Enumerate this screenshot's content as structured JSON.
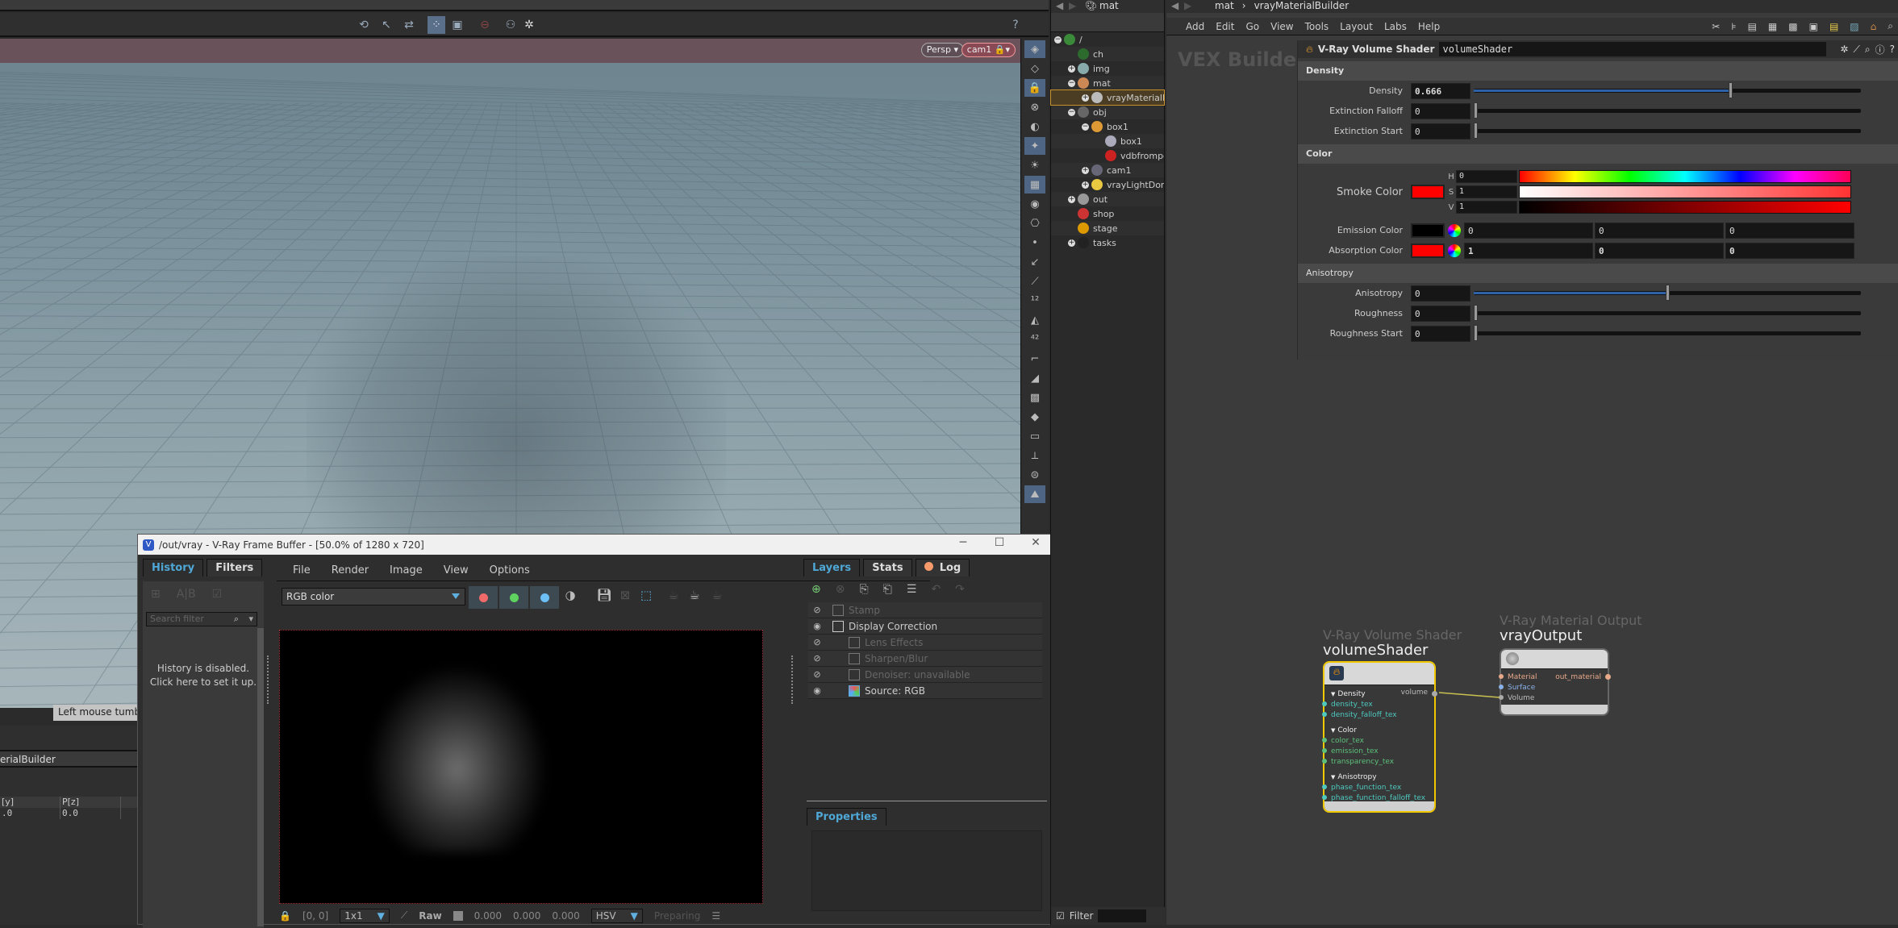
{
  "viewport": {
    "camera_persp": "Persp",
    "camera_name": "cam1",
    "tooltip": "Left mouse tumbles",
    "toolbar_icons": [
      "orbit-icon",
      "select-icon",
      "transform-icon",
      "snap-icon",
      "view-icon",
      "record-icon",
      "flipbook-icon",
      "gear-icon"
    ]
  },
  "lower_left": {
    "path_fragment": "erialBuilder",
    "columns": [
      "[y]",
      "P[z]"
    ],
    "rows": [
      [
        ".0",
        "0.0"
      ]
    ]
  },
  "vfb": {
    "title": "/out/vray - V-Ray Frame Buffer - [50.0% of 1280 x 720]",
    "left_tabs": [
      "History",
      "Filters"
    ],
    "history_search_placeholder": "Search filter",
    "history_message_line1": "History is disabled.",
    "history_message_line2": "Click here to set it up.",
    "menu": [
      "File",
      "Render",
      "Image",
      "View",
      "Options"
    ],
    "channel": "RGB color",
    "right_tabs": [
      "Layers",
      "Stats",
      "Log"
    ],
    "layers": [
      {
        "name": "Stamp",
        "visible": false,
        "enabled": false,
        "indent": 0
      },
      {
        "name": "Display Correction",
        "visible": true,
        "enabled": true,
        "indent": 0
      },
      {
        "name": "Lens Effects",
        "visible": false,
        "enabled": false,
        "indent": 1
      },
      {
        "name": "Sharpen/Blur",
        "visible": false,
        "enabled": false,
        "indent": 1
      },
      {
        "name": "Denoiser: unavailable",
        "visible": false,
        "enabled": false,
        "indent": 1
      },
      {
        "name": "Source: RGB",
        "visible": true,
        "enabled": true,
        "indent": 1
      }
    ],
    "properties_tab": "Properties",
    "status": {
      "coords": "[0, 0]",
      "sampling": "1x1",
      "mode": "Raw",
      "r": "0.000",
      "g": "0.000",
      "b": "0.000",
      "color_space": "HSV",
      "state": "Preparing"
    }
  },
  "tree": {
    "path": "mat",
    "filter_label": "Filter",
    "items": [
      {
        "label": "/",
        "depth": 0,
        "icon": "globe-icon",
        "expanded": true
      },
      {
        "label": "ch",
        "depth": 1,
        "icon": "channel-icon"
      },
      {
        "label": "img",
        "depth": 1,
        "icon": "image-icon",
        "collapsed": true
      },
      {
        "label": "mat",
        "depth": 1,
        "icon": "material-icon",
        "expanded": true
      },
      {
        "label": "vrayMaterialBuilder",
        "depth": 2,
        "icon": "sphere-icon",
        "selected": true
      },
      {
        "label": "obj",
        "depth": 1,
        "icon": "object-icon",
        "expanded": true
      },
      {
        "label": "box1",
        "depth": 2,
        "icon": "geometry-icon",
        "expanded": true
      },
      {
        "label": "box1",
        "depth": 3,
        "icon": "box-icon"
      },
      {
        "label": "vdbfrompolygons",
        "depth": 3,
        "icon": "vdb-icon"
      },
      {
        "label": "cam1",
        "depth": 2,
        "icon": "camera-icon"
      },
      {
        "label": "vrayLightDome",
        "depth": 2,
        "icon": "dome-light-icon"
      },
      {
        "label": "out",
        "depth": 1,
        "icon": "output-icon",
        "collapsed": true
      },
      {
        "label": "shop",
        "depth": 1,
        "icon": "shop-icon"
      },
      {
        "label": "stage",
        "depth": 1,
        "icon": "stage-icon"
      },
      {
        "label": "tasks",
        "depth": 1,
        "icon": "tasks-icon",
        "collapsed": true
      }
    ]
  },
  "network": {
    "path": [
      "mat",
      "vrayMaterialBuilder"
    ],
    "menu": [
      "Add",
      "Edit",
      "Go",
      "View",
      "Tools",
      "Layout",
      "Labs",
      "Help"
    ],
    "context_label": "VEX Builder"
  },
  "params": {
    "node_type": "V-Ray Volume Shader",
    "node_name": "volumeShader",
    "sections": {
      "density": "Density",
      "color": "Color",
      "anisotropy": "Anisotropy"
    },
    "density": {
      "label": "Density",
      "value": "0.666",
      "fraction": 0.666
    },
    "extinction_falloff": {
      "label": "Extinction Falloff",
      "value": "0",
      "fraction": 0
    },
    "extinction_start": {
      "label": "Extinction Start",
      "value": "0",
      "fraction": 0
    },
    "smoke_color": {
      "label": "Smoke Color",
      "h": "0",
      "s": "1",
      "v": "1",
      "swatch": "#ff0000"
    },
    "emission_color": {
      "label": "Emission Color",
      "r": "0",
      "g": "0",
      "b": "0",
      "swatch": "#000000"
    },
    "absorption_color": {
      "label": "Absorption Color",
      "r": "1",
      "g": "0",
      "b": "0",
      "swatch": "#ff0000"
    },
    "anisotropy": {
      "label": "Anisotropy",
      "value": "0",
      "fraction": 0.5
    },
    "roughness": {
      "label": "Roughness",
      "value": "0",
      "fraction": 0
    },
    "roughness_start": {
      "label": "Roughness Start",
      "value": "0",
      "fraction": 0
    }
  },
  "nodes": {
    "volume": {
      "type": "V-Ray Volume Shader",
      "name": "volumeShader",
      "output": "volume",
      "groups": [
        {
          "label": "Density",
          "inputs": [
            "density_tex",
            "density_falloff_tex"
          ]
        },
        {
          "label": "Color",
          "inputs": [
            "color_tex",
            "emission_tex",
            "transparency_tex"
          ]
        },
        {
          "label": "Anisotropy",
          "inputs": [
            "phase_function_tex",
            "phase_function_falloff_tex"
          ]
        }
      ]
    },
    "output": {
      "type": "V-Ray Material Output",
      "name": "vrayOutput",
      "inputs": [
        "Material",
        "Surface",
        "Volume"
      ],
      "output": "out_material"
    }
  },
  "colors": {
    "accent_blue": "#4fa7d6",
    "selected_node": "#f0c800",
    "slider_fill": "#2e62a8"
  }
}
